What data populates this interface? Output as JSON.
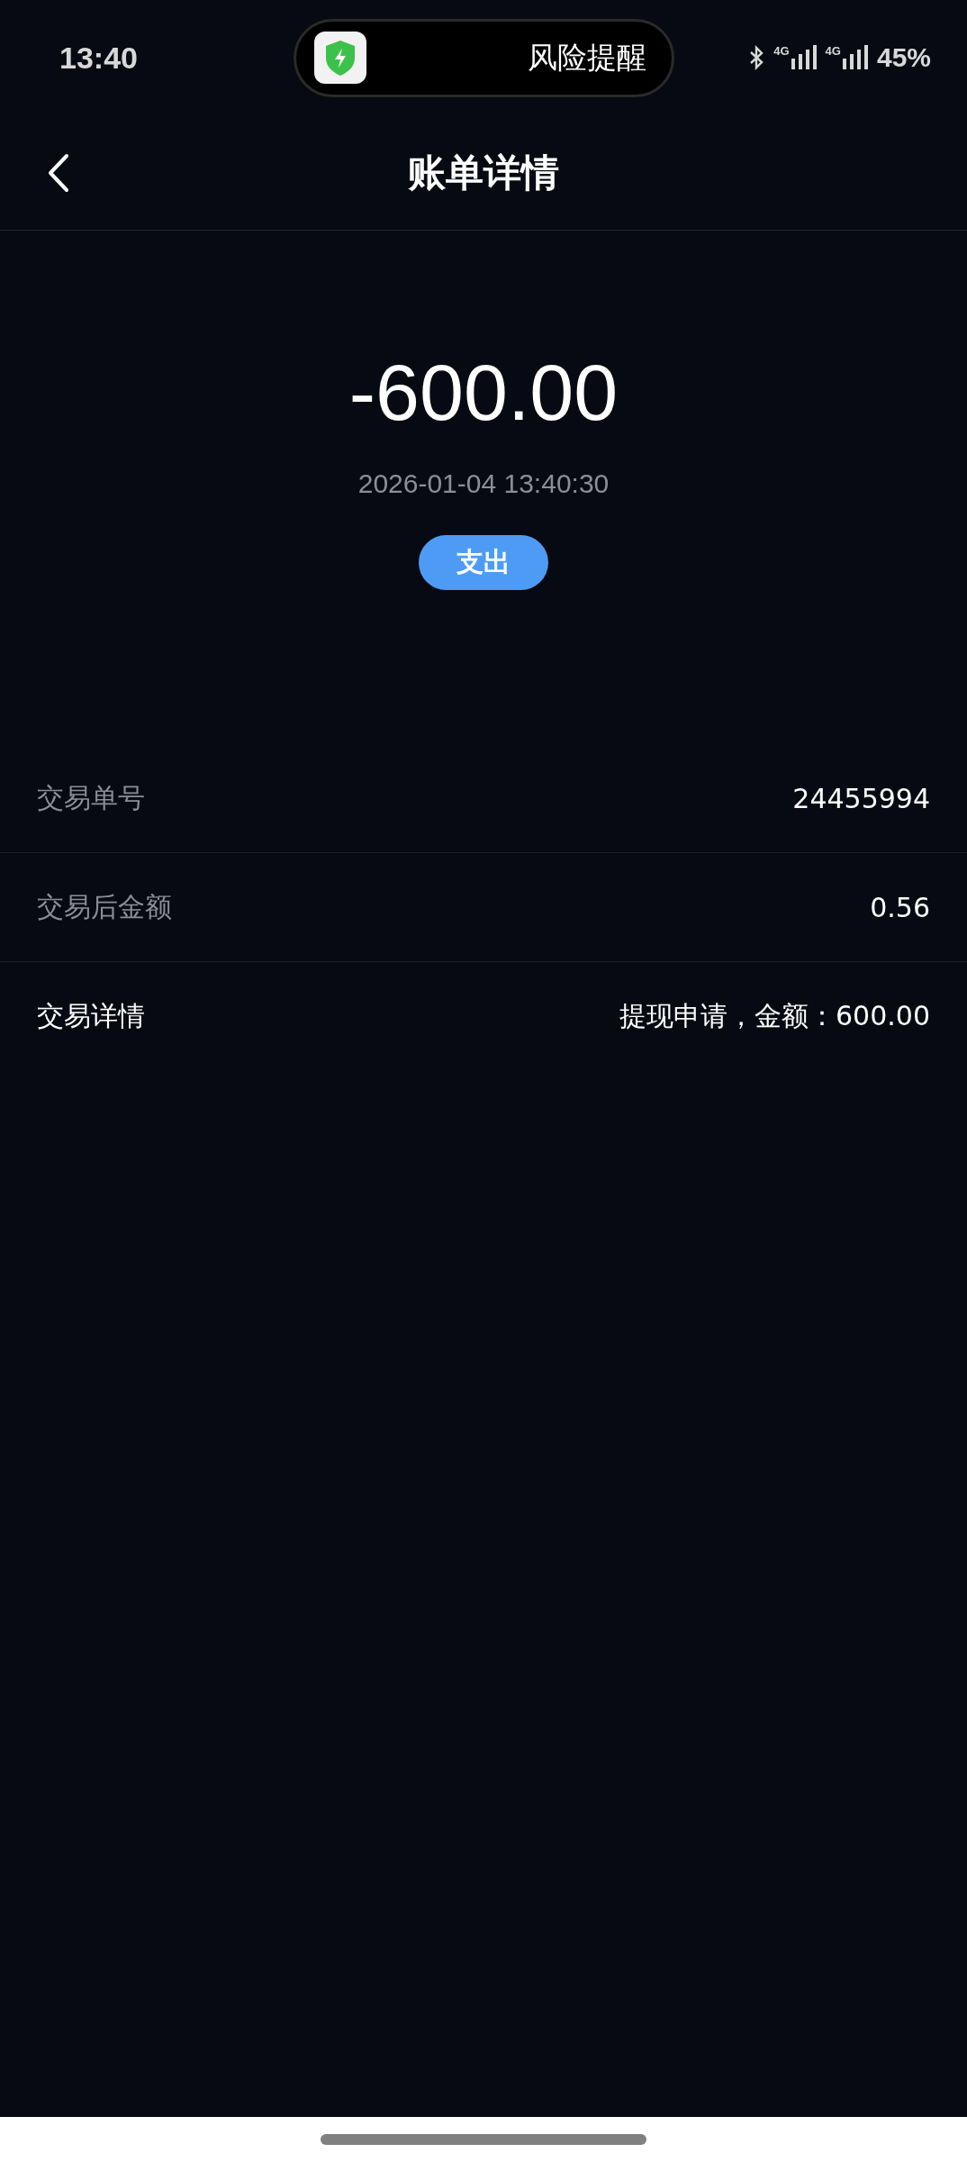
{
  "status_bar": {
    "time": "13:40",
    "alert": "风险提醒",
    "battery": "45%",
    "network_labels": [
      "4G",
      "4G"
    ]
  },
  "header": {
    "title": "账单详情"
  },
  "summary": {
    "amount": "-600.00",
    "datetime": "2026-01-04 13:40:30",
    "type_tag": "支出"
  },
  "rows": [
    {
      "label": "交易单号",
      "value": "24455994",
      "emphasized": false
    },
    {
      "label": "交易后金额",
      "value": "0.56",
      "emphasized": false
    },
    {
      "label": "交易详情",
      "value": "提现申请，金额：600.00",
      "emphasized": true
    }
  ]
}
